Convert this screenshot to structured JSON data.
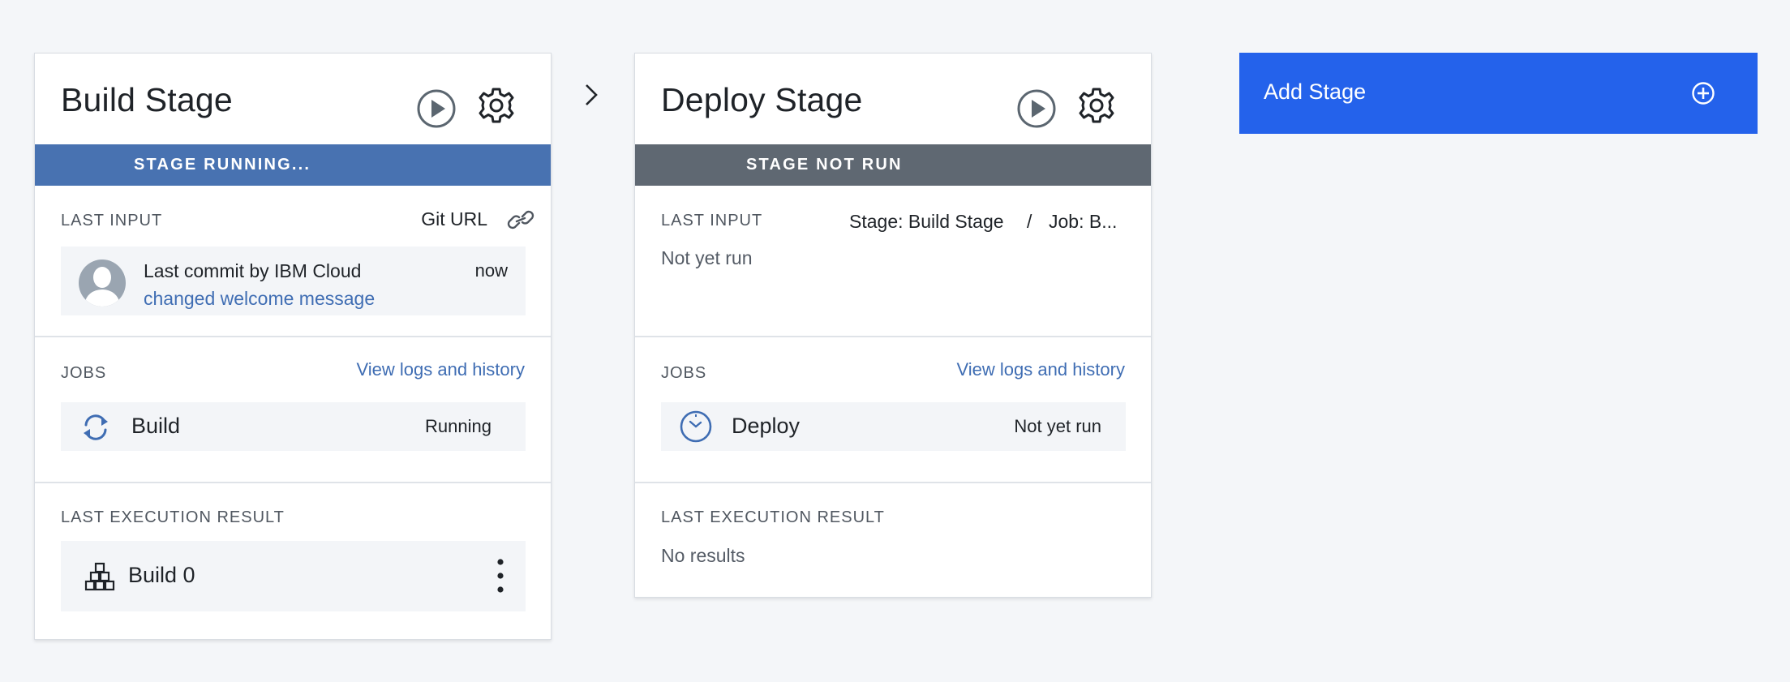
{
  "build_stage": {
    "title": "Build Stage",
    "status": "STAGE RUNNING...",
    "last_input": {
      "label": "LAST INPUT",
      "source": "Git URL",
      "commit_author": "Last commit by IBM Cloud",
      "commit_time": "now",
      "commit_message": "changed welcome message"
    },
    "jobs": {
      "label": "JOBS",
      "link": "View logs and history",
      "items": [
        {
          "name": "Build",
          "status": "Running",
          "icon": "refresh-icon"
        }
      ]
    },
    "last_execution": {
      "label": "LAST EXECUTION RESULT",
      "result": "Build 0"
    }
  },
  "deploy_stage": {
    "title": "Deploy Stage",
    "status": "STAGE NOT RUN",
    "last_input": {
      "label": "LAST INPUT",
      "source": "Stage: Build Stage",
      "separator": "/",
      "job": "Job: B...",
      "value": "Not yet run"
    },
    "jobs": {
      "label": "JOBS",
      "link": "View logs and history",
      "items": [
        {
          "name": "Deploy",
          "status": "Not yet run",
          "icon": "clock-icon"
        }
      ]
    },
    "last_execution": {
      "label": "LAST EXECUTION RESULT",
      "result": "No results"
    }
  },
  "add_stage": {
    "label": "Add Stage"
  },
  "colors": {
    "running": "#4872b1",
    "not_run": "#5f6872",
    "accent": "#2462eb",
    "link": "#3f6db3"
  }
}
